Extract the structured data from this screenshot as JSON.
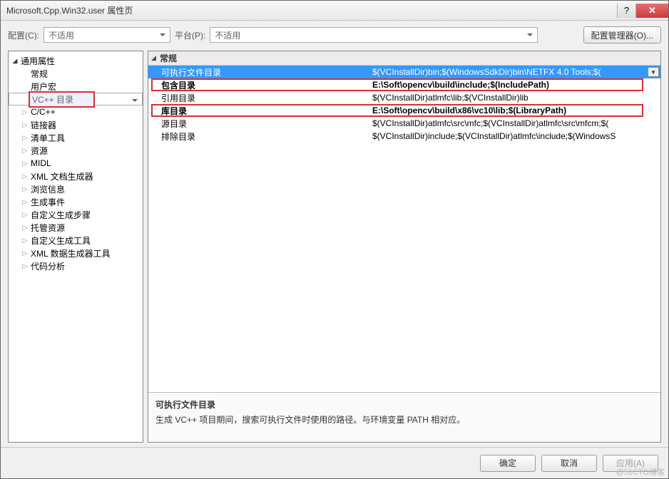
{
  "window": {
    "title": "Microsoft.Cpp.Win32.user 属性页",
    "help": "?",
    "close": "✕"
  },
  "toolbar": {
    "config_label": "配置(C):",
    "config_value": "不适用",
    "platform_label": "平台(P):",
    "platform_value": "不适用",
    "manager": "配置管理器(O)..."
  },
  "tree": {
    "root": "通用属性",
    "items": [
      {
        "label": "常规",
        "expander": false
      },
      {
        "label": "用户宏",
        "expander": false
      },
      {
        "label": "VC++ 目录",
        "expander": false,
        "selected": true,
        "highlight": true
      },
      {
        "label": "C/C++",
        "expander": true
      },
      {
        "label": "链接器",
        "expander": true
      },
      {
        "label": "清单工具",
        "expander": true
      },
      {
        "label": "资源",
        "expander": true
      },
      {
        "label": "MIDL",
        "expander": true
      },
      {
        "label": "XML 文档生成器",
        "expander": true
      },
      {
        "label": "浏览信息",
        "expander": true
      },
      {
        "label": "生成事件",
        "expander": true
      },
      {
        "label": "自定义生成步骤",
        "expander": true
      },
      {
        "label": "托管资源",
        "expander": true
      },
      {
        "label": "自定义生成工具",
        "expander": true
      },
      {
        "label": "XML 数据生成器工具",
        "expander": true
      },
      {
        "label": "代码分析",
        "expander": true
      }
    ]
  },
  "grid": {
    "group": "常规",
    "rows": [
      {
        "key": "可执行文件目录",
        "val": "$(VCInstallDir)bin;$(WindowsSdkDir)bin\\NETFX 4.0 Tools;$(",
        "selected": true
      },
      {
        "key": "包含目录",
        "val": "E:\\Soft\\opencv\\build\\include;$(IncludePath)",
        "bold": true,
        "box": true
      },
      {
        "key": "引用目录",
        "val": "$(VCInstallDir)atlmfc\\lib;$(VCInstallDir)lib"
      },
      {
        "key": "库目录",
        "val": "E:\\Soft\\opencv\\build\\x86\\vc10\\lib;$(LibraryPath)",
        "bold": true,
        "box": true
      },
      {
        "key": "源目录",
        "val": "$(VCInstallDir)atlmfc\\src\\mfc;$(VCInstallDir)atlmfc\\src\\mfcm;$("
      },
      {
        "key": "排除目录",
        "val": "$(VCInstallDir)include;$(VCInstallDir)atlmfc\\include;$(WindowsS"
      }
    ]
  },
  "desc": {
    "title": "可执行文件目录",
    "body": "生成 VC++ 项目期间，搜索可执行文件时使用的路径。与环境变量 PATH 相对应。"
  },
  "footer": {
    "ok": "确定",
    "cancel": "取消",
    "apply": "应用(A)"
  },
  "watermark": "@51CTO博客"
}
